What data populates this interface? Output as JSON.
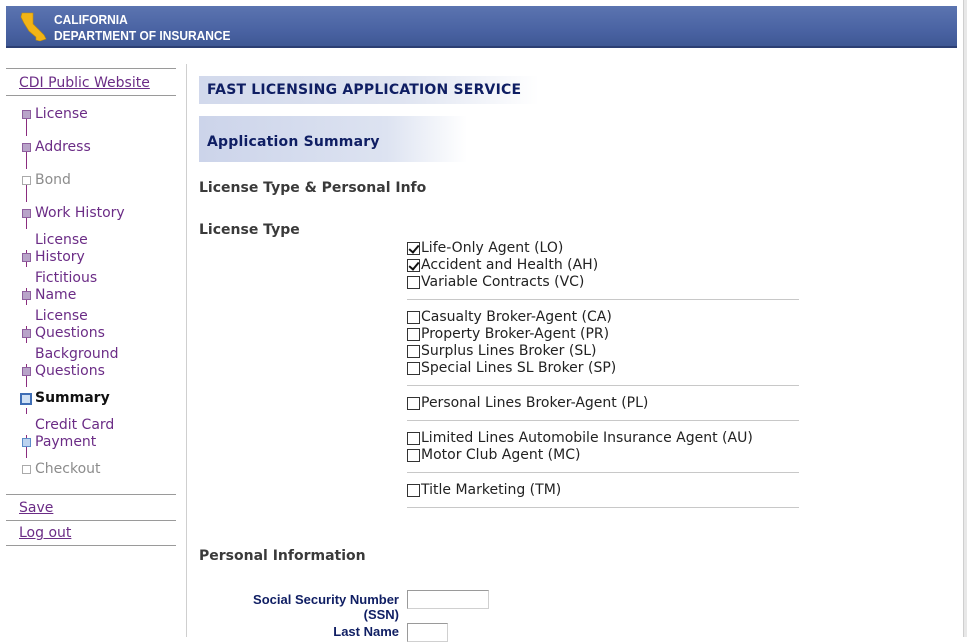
{
  "header": {
    "org_line1": "CALIFORNIA",
    "org_line2": "DEPARTMENT OF INSURANCE",
    "bar_color": "#4a63a3"
  },
  "sidebar": {
    "public_website_link": "CDI Public Website",
    "steps": [
      {
        "label_lines": [
          "License"
        ],
        "state": "done"
      },
      {
        "label_lines": [
          "Address"
        ],
        "state": "done"
      },
      {
        "label_lines": [
          "Bond"
        ],
        "state": "disabled"
      },
      {
        "label_lines": [
          "Work History"
        ],
        "state": "done"
      },
      {
        "label_lines": [
          "License",
          "History"
        ],
        "state": "done"
      },
      {
        "label_lines": [
          "Fictitious",
          "Name"
        ],
        "state": "done"
      },
      {
        "label_lines": [
          "License",
          "Questions"
        ],
        "state": "done"
      },
      {
        "label_lines": [
          "Background",
          "Questions"
        ],
        "state": "done"
      },
      {
        "label_lines": [
          "Summary"
        ],
        "state": "current"
      },
      {
        "label_lines": [
          "Credit Card",
          "Payment"
        ],
        "state": "pending"
      },
      {
        "label_lines": [
          "Checkout"
        ],
        "state": "disabled"
      }
    ],
    "save_link": "Save",
    "logout_link": "Log out"
  },
  "main": {
    "service_title": "FAST LICENSING APPLICATION SERVICE",
    "page_title": "Application Summary",
    "section_license_personal": "License Type & Personal Info",
    "section_license_type": "License Type",
    "license_groups": [
      [
        {
          "label": "Life-Only Agent (LO)",
          "checked": true
        },
        {
          "label": "Accident and Health (AH)",
          "checked": true
        },
        {
          "label": "Variable Contracts (VC)",
          "checked": false
        }
      ],
      [
        {
          "label": "Casualty Broker-Agent (CA)",
          "checked": false
        },
        {
          "label": "Property Broker-Agent (PR)",
          "checked": false
        },
        {
          "label": "Surplus Lines Broker (SL)",
          "checked": false
        },
        {
          "label": "Special Lines SL Broker (SP)",
          "checked": false
        }
      ],
      [
        {
          "label": "Personal Lines Broker-Agent (PL)",
          "checked": false
        }
      ],
      [
        {
          "label": "Limited Lines Automobile Insurance Agent (AU)",
          "checked": false
        },
        {
          "label": "Motor Club Agent (MC)",
          "checked": false
        }
      ],
      [
        {
          "label": "Title Marketing (TM)",
          "checked": false
        }
      ]
    ],
    "section_personal_info": "Personal Information",
    "ssn_label_line1": "Social Security Number",
    "ssn_label_line2": "(SSN)",
    "ssn_value": "",
    "last_name_label": "Last Name",
    "last_name_value": ""
  }
}
